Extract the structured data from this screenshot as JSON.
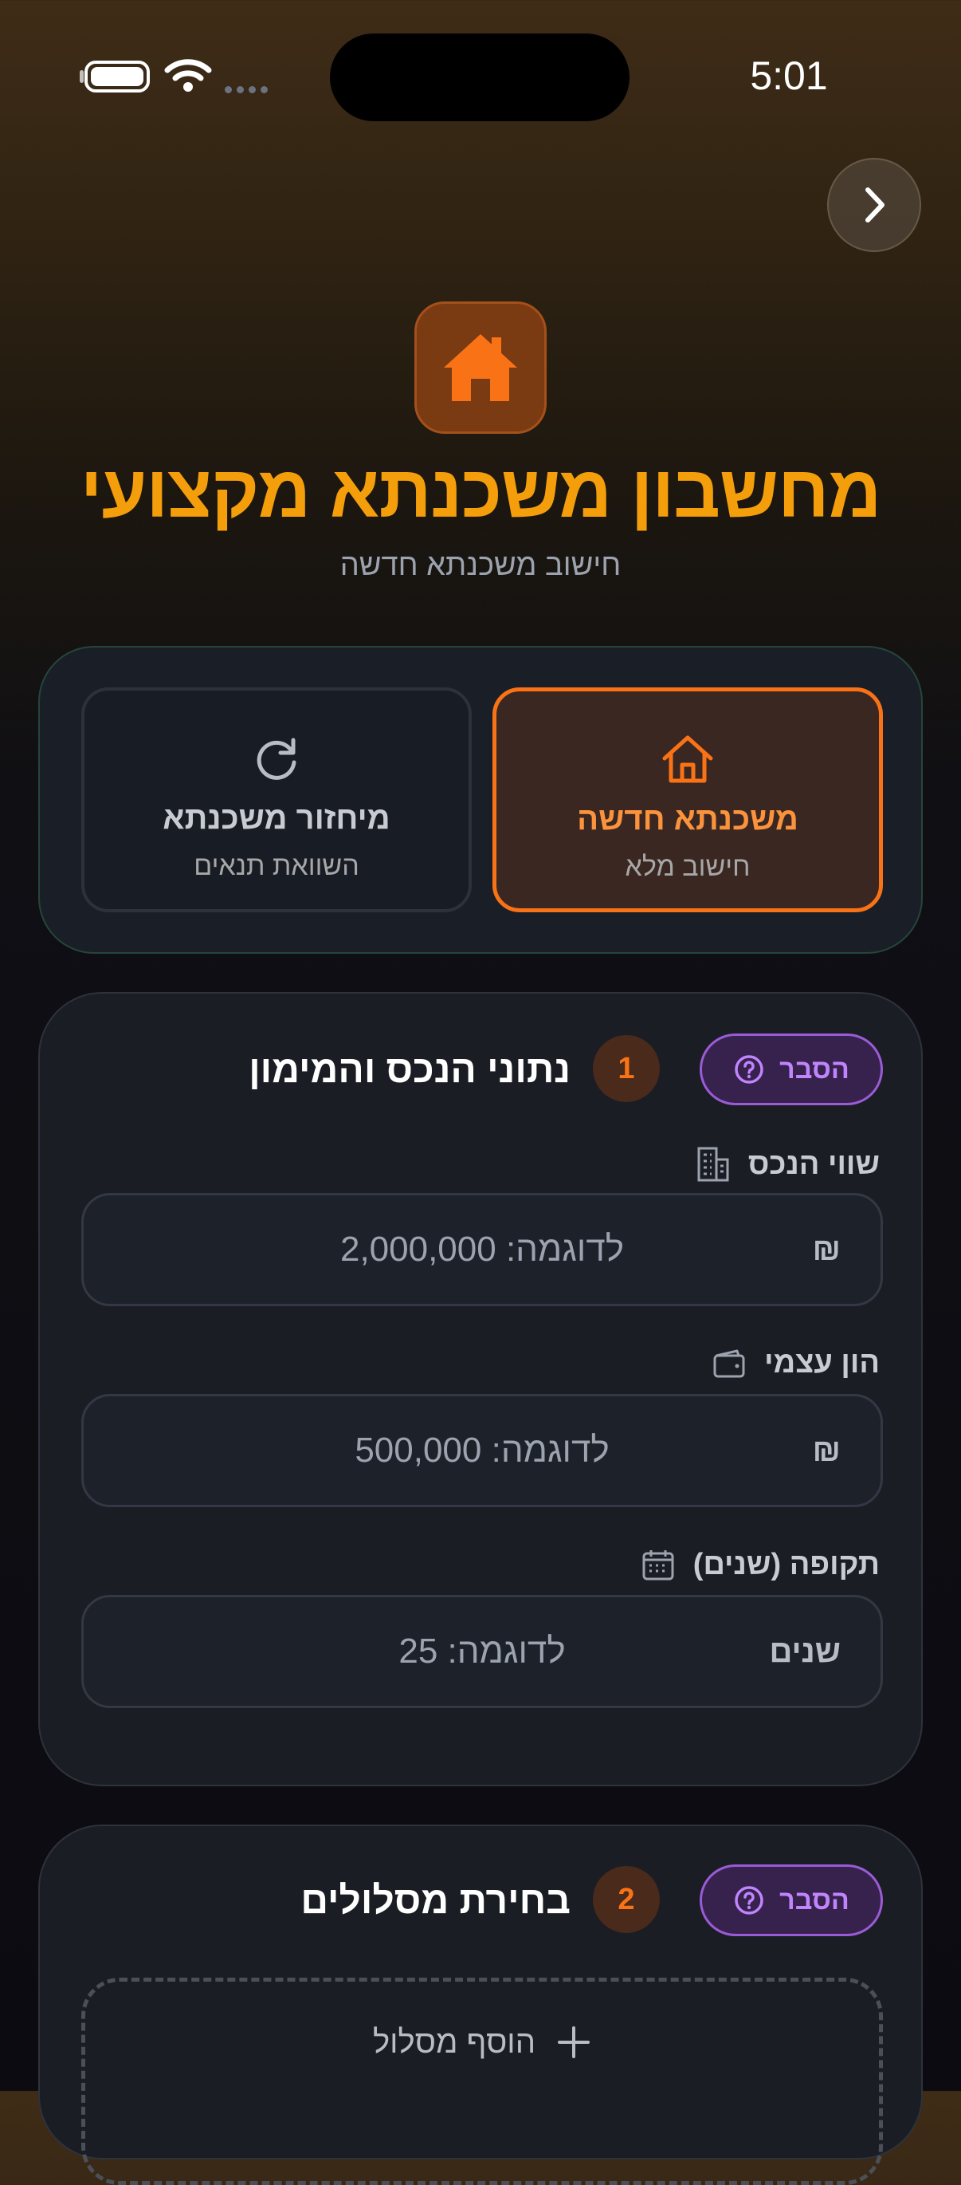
{
  "status_bar": {
    "time": "5:01"
  },
  "header": {
    "title": "מחשבון משכנתא מקצועי",
    "subtitle": "חישוב משכנתא חדשה"
  },
  "modes": [
    {
      "title": "משכנתא חדשה",
      "subtitle": "חישוב מלא",
      "selected": true
    },
    {
      "title": "מיחזור משכנתא",
      "subtitle": "השוואת תנאים",
      "selected": false
    }
  ],
  "section1": {
    "step": "1",
    "title": "נתוני הנכס והמימון",
    "help_label": "הסבר",
    "fields": [
      {
        "label": "שווי הנכס",
        "placeholder": "לדוגמה: 2,000,000",
        "unit": "₪",
        "icon": "building-icon"
      },
      {
        "label": "הון עצמי",
        "placeholder": "לדוגמה: 500,000",
        "unit": "₪",
        "icon": "wallet-icon"
      },
      {
        "label": "תקופה (שנים)",
        "placeholder": "לדוגמה: 25",
        "unit": "שנים",
        "icon": "calendar-icon"
      }
    ]
  },
  "section2": {
    "step": "2",
    "title": "בחירת מסלולים",
    "help_label": "הסבר",
    "add_track_label": "הוסף מסלול"
  },
  "colors": {
    "accent": "#f97316",
    "title": "#f59e0b",
    "help": "#c084fc"
  }
}
